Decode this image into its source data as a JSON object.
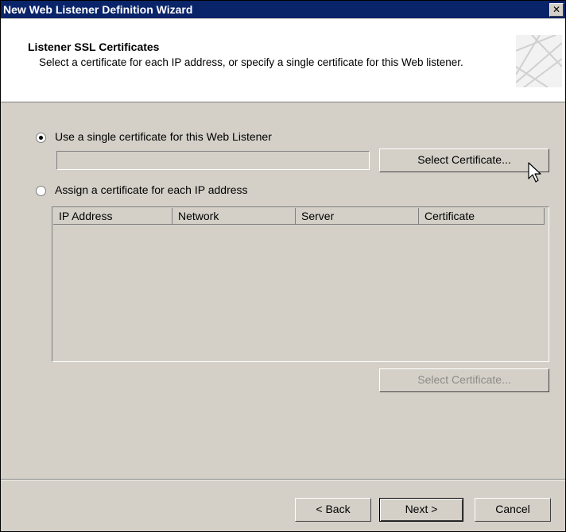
{
  "window": {
    "title": "New Web Listener Definition Wizard",
    "close_glyph": "✕"
  },
  "header": {
    "title": "Listener SSL Certificates",
    "description": "Select a certificate for each IP address, or specify a single certificate for this Web listener."
  },
  "options": {
    "single": {
      "label": "Use a single certificate for this Web Listener",
      "selected": true,
      "certificate_value": ""
    },
    "per_ip": {
      "label": "Assign a certificate for each IP address",
      "selected": false
    }
  },
  "buttons": {
    "select_certificate_single": "Select Certificate...",
    "select_certificate_per_ip": "Select Certificate...",
    "back": "< Back",
    "next": "Next >",
    "cancel": "Cancel"
  },
  "table": {
    "columns": [
      "IP Address",
      "Network",
      "Server",
      "Certificate"
    ],
    "rows": []
  },
  "icons": {
    "cursor": "arrow-cursor-icon",
    "header_art": "wizard-banner-icon"
  }
}
